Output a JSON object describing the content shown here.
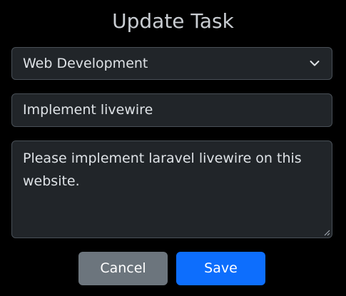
{
  "dialog": {
    "title": "Update Task"
  },
  "form": {
    "category_select": {
      "selected": "Web Development"
    },
    "task_name": {
      "value": "Implement livewire"
    },
    "description": {
      "value": "Please implement laravel livewire on this website."
    }
  },
  "actions": {
    "cancel_label": "Cancel",
    "save_label": "Save"
  },
  "colors": {
    "background": "#000000",
    "field_background": "#212529",
    "cancel_button": "#6c757d",
    "save_button": "#0d6efd"
  },
  "icons": {
    "select_chevron": "chevron-down-icon",
    "textarea_resize": "resize-grip-icon"
  }
}
